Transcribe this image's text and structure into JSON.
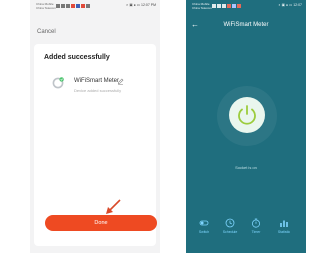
{
  "left_phone": {
    "carrier": [
      "China Mobile",
      "China Telecom"
    ],
    "status_right": "◐ ▣ ● ▭ 12:07 PM",
    "cancel_label": "Cancel",
    "title": "Added successfully",
    "device": {
      "name": "WiFiSmart Meter",
      "status": "Device added successfully"
    },
    "done_label": "Done"
  },
  "right_phone": {
    "carrier": [
      "China Mobile",
      "China Telecom"
    ],
    "status_right": "◐ ▣ ● ▭ 12:07",
    "title": "WiFiSmart Meter",
    "socket_status": "Socket is on",
    "nav": [
      {
        "icon": "switch-icon",
        "label": "Switch"
      },
      {
        "icon": "schedule-icon",
        "label": "Schedule"
      },
      {
        "icon": "timer-icon",
        "label": "Timer"
      },
      {
        "icon": "statistics-icon",
        "label": "Statistic"
      }
    ]
  },
  "colors": {
    "accent_orange": "#ee4a22",
    "teal_background": "#1f6e7e",
    "power_green": "#9ccc3c",
    "nav_blue": "#7fd6ff"
  }
}
